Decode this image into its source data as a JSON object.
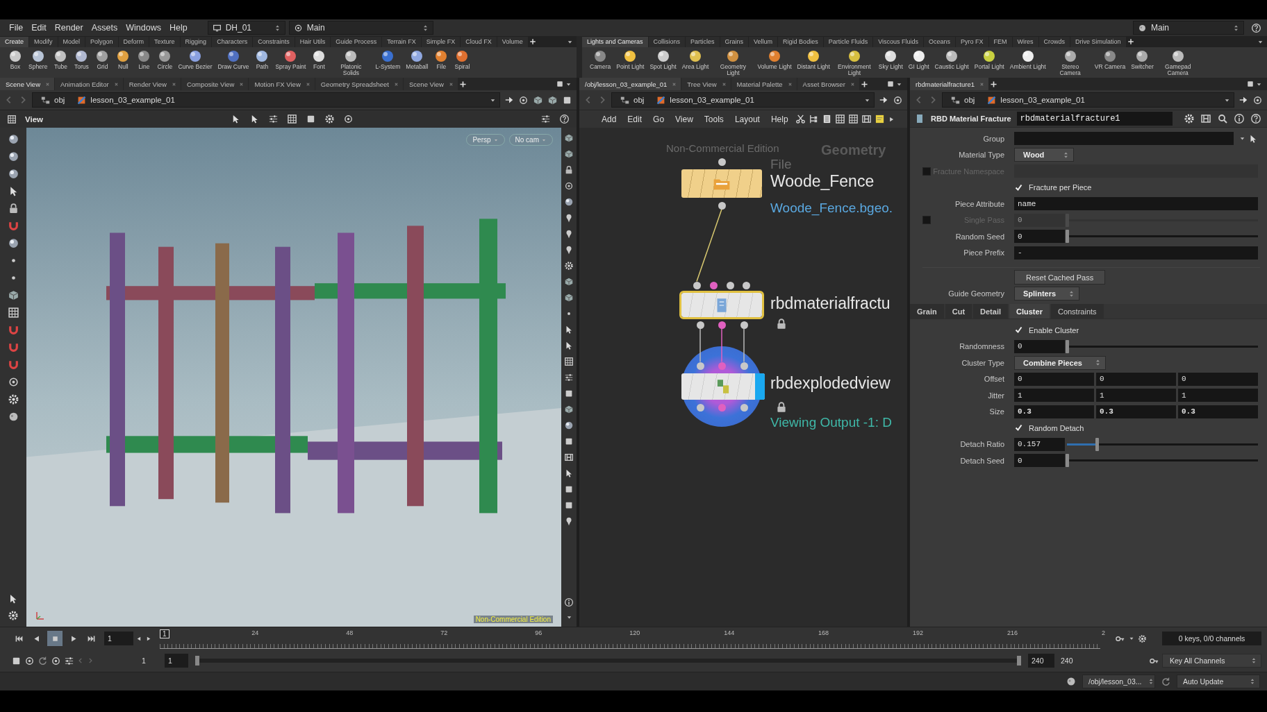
{
  "menu_bar": {
    "items": [
      "File",
      "Edit",
      "Render",
      "Assets",
      "Windows",
      "Help"
    ],
    "desktop": "DH_01",
    "context": "Main",
    "right_context": "Main"
  },
  "shelves": [
    {
      "tabs": [
        {
          "label": "Create",
          "selected": true
        },
        {
          "label": "Modify",
          "selected": false
        },
        {
          "label": "Model",
          "selected": false
        },
        {
          "label": "Polygon",
          "selected": false
        },
        {
          "label": "Deform",
          "selected": false
        },
        {
          "label": "Texture",
          "selected": false
        },
        {
          "label": "Rigging",
          "selected": false
        },
        {
          "label": "Characters",
          "selected": false
        },
        {
          "label": "Constraints",
          "selected": false
        },
        {
          "label": "Hair Utils",
          "selected": false
        },
        {
          "label": "Guide Process",
          "selected": false
        },
        {
          "label": "Terrain FX",
          "selected": false
        },
        {
          "label": "Simple FX",
          "selected": false
        },
        {
          "label": "Cloud FX",
          "selected": false
        },
        {
          "label": "Volume",
          "selected": false
        }
      ],
      "tools": [
        "Box",
        "Sphere",
        "Tube",
        "Torus",
        "Grid",
        "Null",
        "Line",
        "Circle",
        "Curve Bezier",
        "Draw Curve",
        "Path",
        "Spray Paint",
        "Font",
        "Platonic Solids",
        "L-System",
        "Metaball",
        "File",
        "Spiral"
      ]
    },
    {
      "tabs": [
        {
          "label": "Lights and Cameras",
          "selected": true
        },
        {
          "label": "Collisions",
          "selected": false
        },
        {
          "label": "Particles",
          "selected": false
        },
        {
          "label": "Grains",
          "selected": false
        },
        {
          "label": "Vellum",
          "selected": false
        },
        {
          "label": "Rigid Bodies",
          "selected": false
        },
        {
          "label": "Particle Fluids",
          "selected": false
        },
        {
          "label": "Viscous Fluids",
          "selected": false
        },
        {
          "label": "Oceans",
          "selected": false
        },
        {
          "label": "Pyro FX",
          "selected": false
        },
        {
          "label": "FEM",
          "selected": false
        },
        {
          "label": "Wires",
          "selected": false
        },
        {
          "label": "Crowds",
          "selected": false
        },
        {
          "label": "Drive Simulation",
          "selected": false
        }
      ],
      "tools": [
        "Camera",
        "Point Light",
        "Spot Light",
        "Area Light",
        "Geometry Light",
        "Volume Light",
        "Distant Light",
        "Environment Light",
        "Sky Light",
        "GI Light",
        "Caustic Light",
        "Portal Light",
        "Ambient Light",
        "Stereo Camera",
        "VR Camera",
        "Switcher",
        "Gamepad Camera"
      ]
    }
  ],
  "viewer_pane": {
    "tabs": [
      {
        "label": "Scene View",
        "selected": true
      },
      {
        "label": "Animation Editor",
        "selected": false
      },
      {
        "label": "Render View",
        "selected": false
      },
      {
        "label": "Composite View",
        "selected": false
      },
      {
        "label": "Motion FX View",
        "selected": false
      },
      {
        "label": "Geometry Spreadsheet",
        "selected": false
      },
      {
        "label": "Scene View",
        "selected": false
      }
    ],
    "path": [
      "obj",
      "lesson_03_example_01"
    ],
    "title": "View",
    "view_buttons": [
      "Persp",
      "No cam"
    ],
    "edition": "Non-Commercial Edition"
  },
  "network_pane": {
    "tabs": [
      {
        "label": "/obj/lesson_03_example_01",
        "selected": true
      },
      {
        "label": "Tree View",
        "selected": false
      },
      {
        "label": "Material Palette",
        "selected": false
      },
      {
        "label": "Asset Browser",
        "selected": false
      }
    ],
    "path": [
      "obj",
      "lesson_03_example_01"
    ],
    "menu": [
      "Add",
      "Edit",
      "Go",
      "View",
      "Tools",
      "Layout",
      "Help"
    ],
    "edition": "Non-Commercial Edition",
    "context": "Geometry",
    "nodes": [
      {
        "kind": "file",
        "type_label": "File",
        "name": "Woode_Fence",
        "detail": "Woode_Fence.bgeo.",
        "selected": false,
        "display": false,
        "locked": false
      },
      {
        "kind": "fracture",
        "name": "rbdmaterialfractu",
        "selected": true,
        "display": false,
        "locked": true
      },
      {
        "kind": "exploded",
        "name": "rbdexplodedview",
        "detail": "Viewing Output -1: D",
        "selected": false,
        "display": true,
        "locked": true
      }
    ]
  },
  "parameter_pane": {
    "tabs": [
      {
        "label": "rbdmaterialfracture1",
        "selected": true
      }
    ],
    "path": [
      "obj",
      "lesson_03_example_01"
    ],
    "node_type": "RBD Material Fracture",
    "node_name": "rbdmaterialfracture1",
    "rows": [
      {
        "kind": "field",
        "label": "Group"
      },
      {
        "kind": "menu",
        "label": "Material Type",
        "value": "Wood"
      },
      {
        "kind": "field",
        "label": "Fracture Namespace",
        "enabled": false
      },
      {
        "kind": "toggle",
        "label": "Fracture per Piece",
        "checked": true
      },
      {
        "kind": "field",
        "label": "Piece Attribute",
        "value": "name"
      },
      {
        "kind": "slider",
        "label": "Single Pass",
        "value": "0",
        "level": 0,
        "enabled": false
      },
      {
        "kind": "slider",
        "label": "Random Seed",
        "value": "0",
        "level": 0
      },
      {
        "kind": "field",
        "label": "Piece Prefix",
        "value": "-"
      },
      {
        "kind": "button",
        "label": "Reset Cached Pass"
      },
      {
        "kind": "menu",
        "label": "Guide Geometry",
        "value": "Splinters"
      },
      {
        "kind": "tabs",
        "tabs": [
          {
            "label": "Grain",
            "selected": false
          },
          {
            "label": "Cut",
            "selected": false
          },
          {
            "label": "Detail",
            "selected": false
          },
          {
            "label": "Cluster",
            "selected": true
          },
          {
            "label": "Constraints",
            "selected": false
          }
        ]
      },
      {
        "kind": "toggle",
        "label": "Enable Cluster",
        "checked": true
      },
      {
        "kind": "slider",
        "label": "Randomness",
        "value": "0",
        "level": 0
      },
      {
        "kind": "menu",
        "label": "Cluster Type",
        "value": "Combine Pieces"
      },
      {
        "kind": "vector",
        "label": "Offset",
        "values": [
          "0",
          "0",
          "0"
        ]
      },
      {
        "kind": "vector",
        "label": "Jitter",
        "values": [
          "1",
          "1",
          "1"
        ]
      },
      {
        "kind": "vector",
        "label": "Size",
        "values": [
          "0.3",
          "0.3",
          "0.3"
        ]
      },
      {
        "kind": "toggle",
        "label": "Random Detach",
        "checked": true
      },
      {
        "kind": "slider",
        "label": "Detach Ratio",
        "value": "0.157",
        "level": 0.157
      },
      {
        "kind": "slider",
        "label": "Detach Seed",
        "value": "0",
        "level": 0
      }
    ]
  },
  "timeline": {
    "playing": false,
    "frame": "1",
    "marker": "1",
    "ticks": [
      "24",
      "48",
      "72",
      "96",
      "120",
      "144",
      "168",
      "192",
      "216",
      "2"
    ],
    "range": [
      "1",
      "1",
      "240",
      "240"
    ],
    "keys": "0 keys, 0/0 channels",
    "key_all": "Key All Channels"
  },
  "status_bar": {
    "path": "/obj/lesson_03...",
    "update_mode": "Auto Update"
  }
}
